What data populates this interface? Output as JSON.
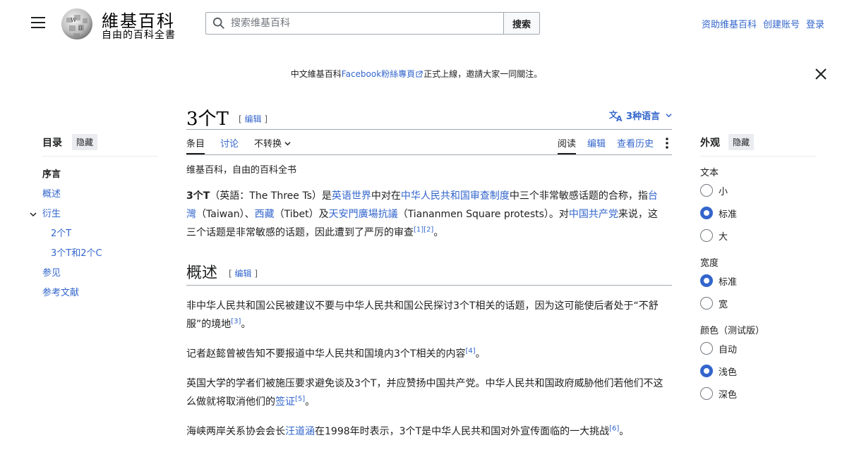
{
  "header": {
    "logo_title": "維基百科",
    "logo_tagline": "自由的百科全書",
    "search_placeholder": "搜索维基百科",
    "search_button": "搜索",
    "links": [
      "资助维基百科",
      "创建账号",
      "登录"
    ]
  },
  "banner": {
    "prefix": "中文維基百科",
    "link": "Facebook粉絲專頁",
    "suffix": "正式上線，邀請大家一同關注。"
  },
  "toc": {
    "title": "目录",
    "hide": "隐藏",
    "items": [
      {
        "label": "序言",
        "level": 0
      },
      {
        "label": "概述",
        "level": 1
      },
      {
        "label": "衍生",
        "level": 1
      },
      {
        "label": "2个T",
        "level": 2
      },
      {
        "label": "3个T和2个C",
        "level": 2
      },
      {
        "label": "参见",
        "level": 1
      },
      {
        "label": "参考文献",
        "level": 1
      }
    ]
  },
  "article": {
    "title": "3个T",
    "edit_label": "编辑",
    "lang_button": "3种语言",
    "tabs_left": [
      "条目",
      "讨论",
      "不转换"
    ],
    "tabs_right": [
      "阅读",
      "编辑",
      "查看历史"
    ],
    "subtitle": "维基百科，自由的百科全书",
    "lead": {
      "bold": "3个T",
      "t1": "（英語：The Three Ts）是",
      "l1": "英语世界",
      "t2": "中对在",
      "l2": "中华人民共和国审查制度",
      "t3": "中三个非常敏感话题的合称，指",
      "l3": "台灣",
      "t4": "（Taiwan）、",
      "l4": "西藏",
      "t5": "（Tibet）及",
      "l5": "天安門廣場抗議",
      "t6": "（Tiananmen Square protests）。对",
      "l6": "中国共产党",
      "t7": "来说，这三个话题是非常敏感的话题，因此遭到了严厉的审查",
      "r1": "[1]",
      "r2": "[2]",
      "t8": "。"
    },
    "section_title": "概述",
    "p1": {
      "text": "非中华人民共和国公民被建议不要与中华人民共和国公民探讨3个T相关的话题，因为这可能使后者处于“不舒服”的境地",
      "ref": "[3]",
      "end": "。"
    },
    "p2": {
      "text": "记者赵懿曾被告知不要报道中华人民共和国境内3个T相关的内容",
      "ref": "[4]",
      "end": "。"
    },
    "p3": {
      "text": "英国大学的学者们被施压要求避免谈及3个T，并应赞扬中国共产党。中华人民共和国政府威胁他们若他们不这么做就将取消他们的",
      "link": "签证",
      "ref": "[5]",
      "end": "。"
    },
    "p4": {
      "t1": "海峡两岸关系协会会长",
      "link": "汪道涵",
      "t2": "在1998年时表示，3个T是中华人民共和国对外宣传面临的一大挑战",
      "ref": "[6]",
      "end": "。"
    }
  },
  "appearance": {
    "title": "外观",
    "hide": "隐藏",
    "text_label": "文本",
    "text_options": [
      "小",
      "标准",
      "大"
    ],
    "width_label": "宽度",
    "width_options": [
      "标准",
      "宽"
    ],
    "color_label": "颜色（测试版）",
    "color_options": [
      "自动",
      "浅色",
      "深色"
    ],
    "selected": {
      "text": "标准",
      "width": "标准",
      "color": "浅色"
    }
  }
}
